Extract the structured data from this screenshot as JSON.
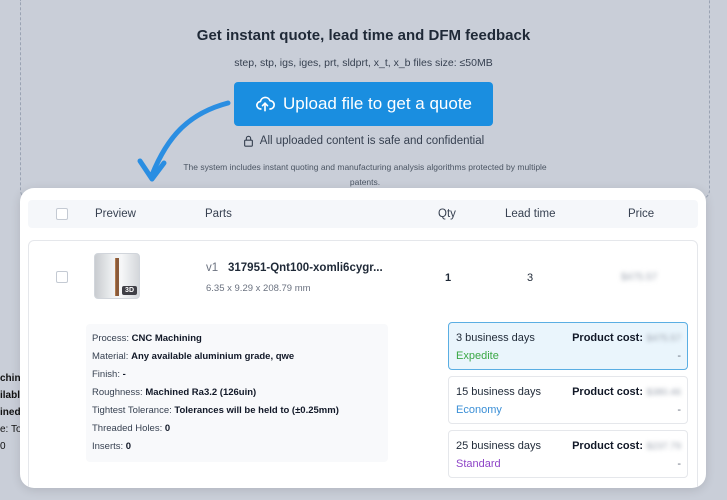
{
  "header": {
    "headline": "Get instant quote, lead time and DFM feedback",
    "formats": "step, stp, igs, iges, prt, sldprt, x_t, x_b files size: ≤50MB",
    "upload_label": "Upload file to get a quote",
    "safe_note": "All uploaded content is safe and confidential",
    "system_note": "The system includes instant quoting and manufacturing analysis algorithms protected by multiple patents."
  },
  "background_strip": [
    "chini",
    "ilable",
    "",
    "ined",
    "e: Tol",
    "0"
  ],
  "table": {
    "columns": {
      "preview": "Preview",
      "parts": "Parts",
      "qty": "Qty",
      "lead_time": "Lead time",
      "price": "Price"
    }
  },
  "part": {
    "version": "v1",
    "name": "317951-Qnt100-xomli6cygr...",
    "dimensions": "6.35 x 9.29 x 208.79 mm",
    "thumb_badge": "3D",
    "qty": "1",
    "lead_time": "3",
    "price": "$475.57"
  },
  "details": [
    {
      "label": "Process: ",
      "value": "CNC Machining"
    },
    {
      "label": "Material: ",
      "value": "Any available aluminium grade, qwe"
    },
    {
      "label": "Finish: ",
      "value": "-"
    },
    {
      "label": "Roughness: ",
      "value": "Machined Ra3.2 (126uin)"
    },
    {
      "label": "Tightest Tolerance: ",
      "value": "Tolerances will be held to (±0.25mm)"
    },
    {
      "label": "Threaded Holes: ",
      "value": "0"
    },
    {
      "label": "Inserts: ",
      "value": "0"
    }
  ],
  "shipping_options": [
    {
      "days": "3 business days",
      "tier": "Expedite",
      "cost_label": "Product cost:",
      "cost": "$475.57",
      "extra": "-",
      "tier_color": "#3aa845"
    },
    {
      "days": "15 business days",
      "tier": "Economy",
      "cost_label": "Product cost:",
      "cost": "$380.46",
      "extra": "-",
      "tier_color": "#3b8fd6"
    },
    {
      "days": "25 business days",
      "tier": "Standard",
      "cost_label": "Product cost:",
      "cost": "$237.79",
      "extra": "-",
      "tier_color": "#8e44c7"
    }
  ],
  "colors": {
    "accent": "#1a8ee0",
    "selected_bg": "#eaf5fc",
    "arrow": "#2a8ee2"
  }
}
